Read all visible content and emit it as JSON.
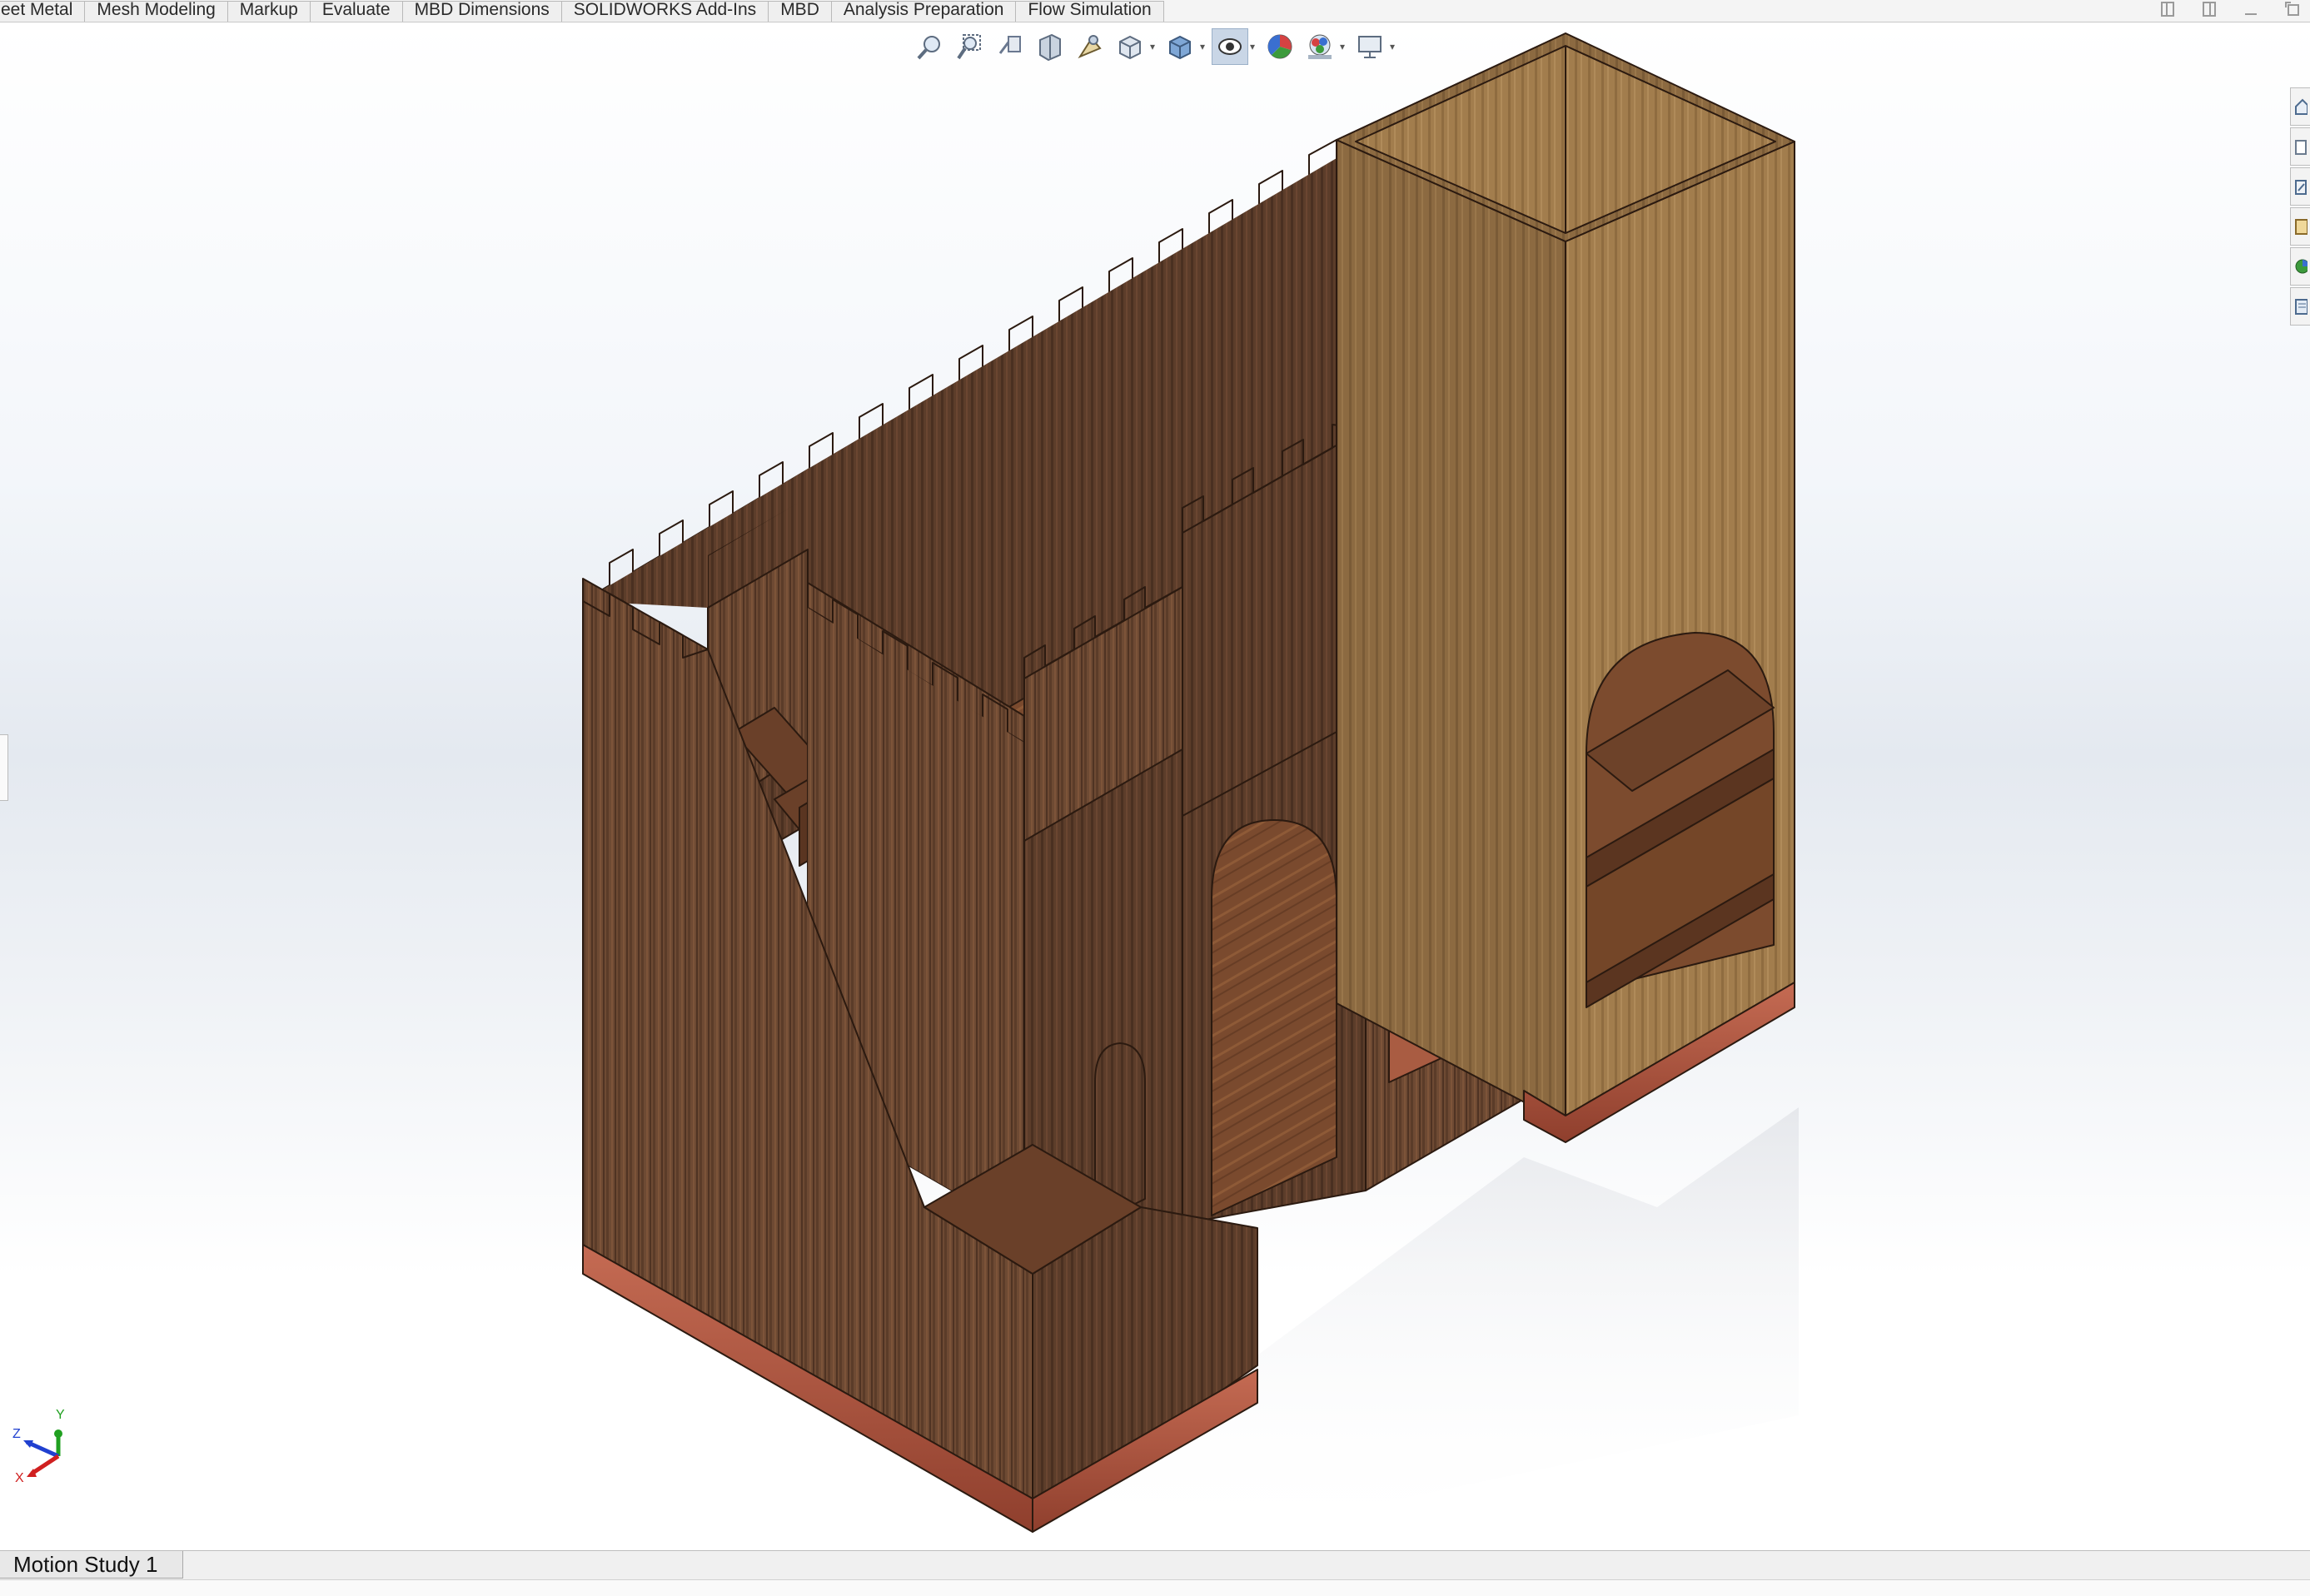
{
  "ribbon": {
    "tabs": [
      "eet Metal",
      "Mesh Modeling",
      "Markup",
      "Evaluate",
      "MBD Dimensions",
      "SOLIDWORKS Add-Ins",
      "MBD",
      "Analysis Preparation",
      "Flow Simulation"
    ]
  },
  "window_controls": [
    "restore-left-icon",
    "restore-right-icon",
    "minimize-icon",
    "maximize-icon"
  ],
  "view_toolbar": {
    "icons": [
      "zoom-to-fit-icon",
      "zoom-to-area-icon",
      "previous-view-icon",
      "section-view-icon",
      "dynamic-annotation-icon",
      "view-orientation-icon",
      "display-style-icon",
      "hide-show-items-icon",
      "edit-appearance-icon",
      "apply-scene-icon",
      "view-settings-icon"
    ],
    "active": "hide-show-items-icon"
  },
  "task_pane": {
    "icons": [
      "home-icon",
      "design-library-icon",
      "file-explorer-icon",
      "view-palette-icon",
      "appearances-icon",
      "custom-properties-icon"
    ]
  },
  "triad": {
    "axes": [
      "Y",
      "Z",
      "X"
    ]
  },
  "colors": {
    "walnut": "#6e4a33",
    "walnut_dark": "#5a3a28",
    "oak": "#a27d4d",
    "oak_dark": "#8a6840",
    "base_trim": "#b45a44",
    "edge_line": "#2b1a10",
    "axis_x": "#d02020",
    "axis_y": "#20a020",
    "axis_z": "#2040d0"
  },
  "bottom": {
    "tabs": [
      "Motion Study 1"
    ]
  }
}
